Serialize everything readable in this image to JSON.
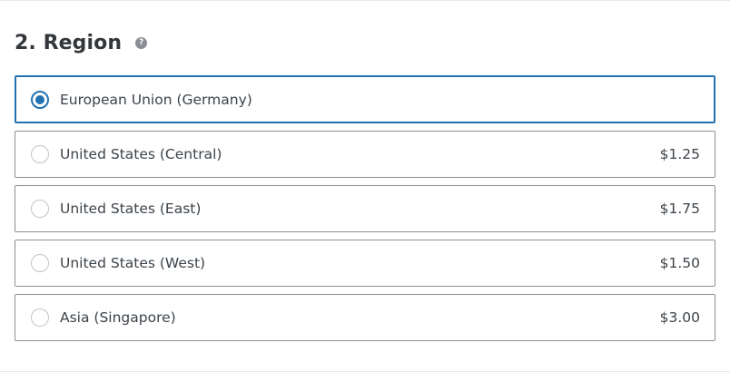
{
  "section": {
    "title": "2. Region",
    "help_icon": "question-icon"
  },
  "colors": {
    "accent": "#2271b1",
    "border": "#8c8f94",
    "text": "#3c434a"
  },
  "regions": [
    {
      "label": "European Union (Germany)",
      "price": "",
      "selected": true
    },
    {
      "label": "United States (Central)",
      "price": "$1.25",
      "selected": false
    },
    {
      "label": "United States (East)",
      "price": "$1.75",
      "selected": false
    },
    {
      "label": "United States (West)",
      "price": "$1.50",
      "selected": false
    },
    {
      "label": "Asia (Singapore)",
      "price": "$3.00",
      "selected": false
    }
  ]
}
